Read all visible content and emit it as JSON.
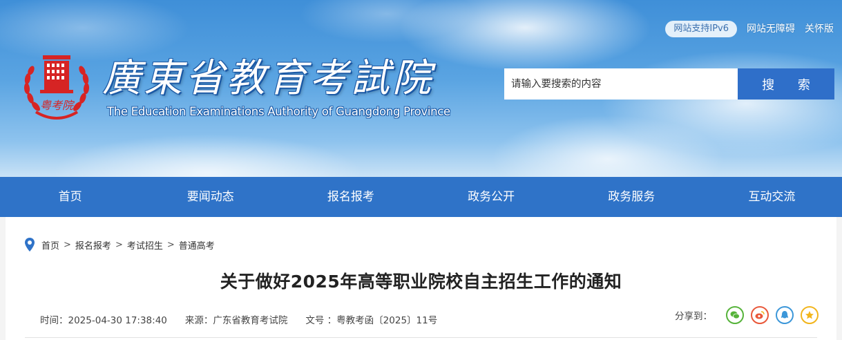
{
  "header": {
    "title": "廣東省教育考試院",
    "subtitle": "The Education Examinations Authority of Guangdong Province",
    "emblem_text": "粤考院",
    "ipv6_label": "网站支持IPv6",
    "accessibility_label": "网站无障碍",
    "care_label": "关怀版"
  },
  "search": {
    "placeholder": "请输入要搜索的内容",
    "button_label": "搜  索"
  },
  "nav": {
    "items": [
      {
        "label": "首页"
      },
      {
        "label": "要闻动态"
      },
      {
        "label": "报名报考"
      },
      {
        "label": "政务公开"
      },
      {
        "label": "政务服务"
      },
      {
        "label": "互动交流"
      }
    ]
  },
  "breadcrumb": {
    "items": [
      "首页",
      "报名报考",
      "考试招生",
      "普通高考"
    ],
    "separator": ">"
  },
  "article": {
    "title": "关于做好2025年高等职业院校自主招生工作的通知",
    "time": "时间：2025-04-30 17:38:40",
    "source": "来源：广东省教育考试院",
    "doc_no": "文号 ：粤教考函〔2025〕11号"
  },
  "share": {
    "label": "分享到：",
    "icons": [
      "wechat-icon",
      "weibo-icon",
      "qq-icon",
      "favorite-icon"
    ]
  },
  "colors": {
    "nav_bg": "#2f73c8",
    "search_button": "#2f6fc9",
    "emblem_red": "#d62424"
  }
}
